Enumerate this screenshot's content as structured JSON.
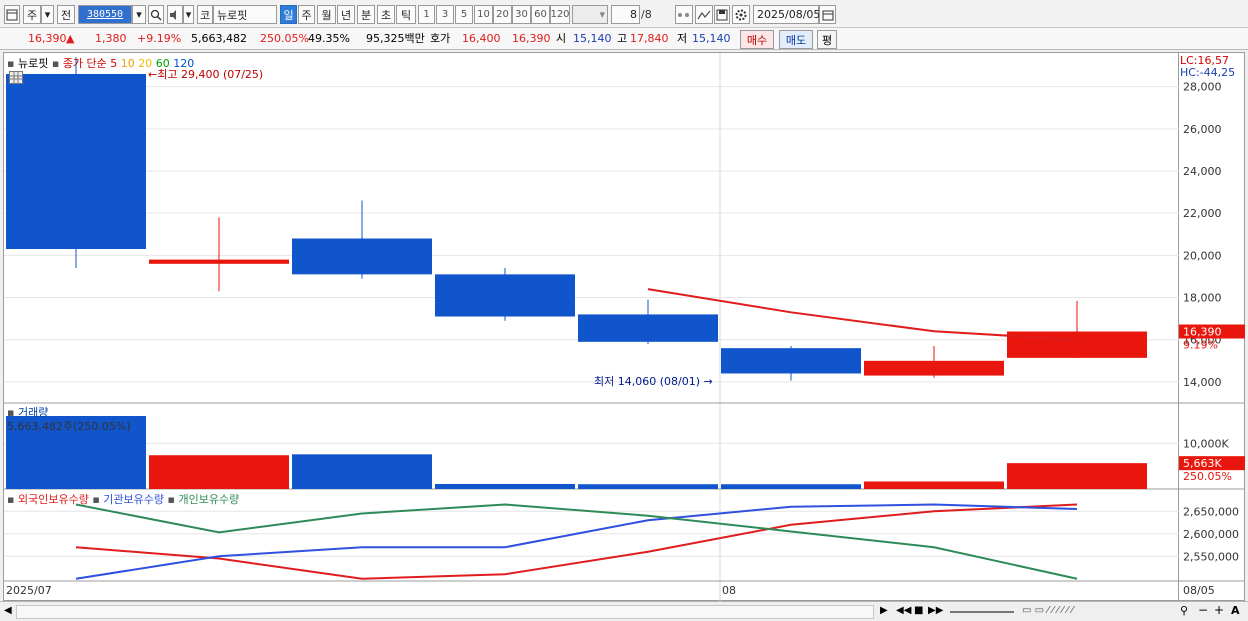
{
  "toolbar": {
    "mode": "주",
    "prev": "전",
    "code": "380550",
    "type_label": "코",
    "name": "뉴로핏",
    "periods": [
      "일",
      "주",
      "월",
      "년",
      "분",
      "초",
      "틱"
    ],
    "active_period": "일",
    "intervals": [
      "1",
      "3",
      "5",
      "10",
      "20",
      "30",
      "60",
      "120"
    ],
    "count": "8",
    "count_total": "/8",
    "date": "2025/08/05"
  },
  "quote": {
    "price": "16,390",
    "arrow": "▲",
    "change": "1,380",
    "change_pct": "+9.19%",
    "volume": "5,663,482",
    "volume_pct": "250.05%",
    "turnover_pct": "49.35%",
    "amount": "95,325백만",
    "bid_label": "호가",
    "bid": "16,400",
    "ask": "16,390",
    "open_label": "시",
    "open": "15,140",
    "high_label": "고",
    "high": "17,840",
    "low_label": "저",
    "low": "15,140",
    "buy_label": "매수",
    "sell_label": "매도",
    "eval_label": "평"
  },
  "price_panel": {
    "name": "뉴로핏",
    "ma_label": "종가 단순",
    "ma_periods": [
      "5",
      "10",
      "20",
      "60",
      "120"
    ],
    "ma_colors": [
      "#d40000",
      "#f0a000",
      "#f0c000",
      "#00a000",
      "#0050d0"
    ],
    "high_note": "최고 29,400 (07/25)",
    "low_note": "최저 14,060 (08/01)",
    "lc": "LC:16,57",
    "hc": "HC:-44,25",
    "last_price_tag": "16,390",
    "last_pct_tag": "9.19%",
    "y_ticks": [
      "28,000",
      "26,000",
      "24,000",
      "22,000",
      "20,000",
      "18,000",
      "16,000",
      "14,000"
    ]
  },
  "volume_panel": {
    "title": "거래량",
    "value_label": "5,663,482주(250.05%)",
    "y_tick": "10,000K",
    "last_tag": "5,663K",
    "last_pct": "250.05%"
  },
  "holdings_panel": {
    "series_names": [
      "외국인보유수량",
      "기관보유수량",
      "개인보유수량"
    ],
    "y_ticks": [
      "2,650,000",
      "2,600,000",
      "2,550,000"
    ]
  },
  "x_axis": {
    "start": "2025/07",
    "mid": "08",
    "end": "08/05"
  },
  "chart_data": [
    {
      "type": "candlestick",
      "ylim": [
        13000,
        29500
      ],
      "series": [
        {
          "open": 28600,
          "high": 29400,
          "low": 19400,
          "close": 20300
        },
        {
          "open": 19600,
          "high": 21800,
          "low": 18300,
          "close": 19800
        },
        {
          "open": 20800,
          "high": 22600,
          "low": 18900,
          "close": 19100
        },
        {
          "open": 19100,
          "high": 19400,
          "low": 16900,
          "close": 17100
        },
        {
          "open": 17200,
          "high": 17900,
          "low": 15800,
          "close": 15900
        },
        {
          "open": 15600,
          "high": 15700,
          "low": 14060,
          "close": 14400
        },
        {
          "open": 14300,
          "high": 15700,
          "low": 14200,
          "close": 15000
        },
        {
          "open": 15140,
          "high": 17840,
          "low": 15140,
          "close": 16390
        }
      ],
      "ma5": [
        null,
        null,
        null,
        null,
        18400,
        17300,
        16400,
        16000
      ]
    },
    {
      "type": "bar",
      "ylim": [
        0,
        16000
      ],
      "values": [
        16000,
        7400,
        7600,
        1100,
        1050,
        1050,
        1650,
        5663
      ],
      "colors": [
        "blue",
        "red",
        "blue",
        "blue",
        "blue",
        "blue",
        "red",
        "red"
      ]
    },
    {
      "type": "line",
      "ylim": [
        2495000,
        2675000
      ],
      "series": [
        {
          "name": "외국인보유수량",
          "color": "#e01c1c",
          "values": [
            2570000,
            2545000,
            2500000,
            2510000,
            2560000,
            2620000,
            2650000,
            2665000
          ]
        },
        {
          "name": "기관보유수량",
          "color": "#3050e0",
          "values": [
            2500000,
            2550000,
            2570000,
            2570000,
            2630000,
            2660000,
            2665000,
            2655000
          ]
        },
        {
          "name": "개인보유수량",
          "color": "#2e8b57",
          "values": [
            2665000,
            2603000,
            2645000,
            2665000,
            2640000,
            2605000,
            2570000,
            2500000
          ]
        }
      ]
    }
  ]
}
